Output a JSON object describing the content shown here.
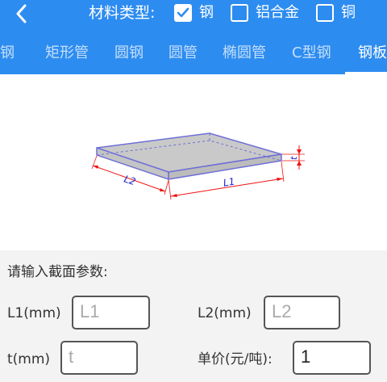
{
  "header": {
    "material_label": "材料类型:",
    "checkboxes": [
      {
        "label": "钢",
        "checked": true
      },
      {
        "label": "铝合金",
        "checked": false
      },
      {
        "label": "铜",
        "checked": false
      }
    ],
    "bg_color": "#2d8cf0"
  },
  "tabs": [
    {
      "label": "角钢",
      "active": false
    },
    {
      "label": "矩形管",
      "active": false
    },
    {
      "label": "圆钢",
      "active": false
    },
    {
      "label": "圆管",
      "active": false
    },
    {
      "label": "椭圆管",
      "active": false
    },
    {
      "label": "C型钢",
      "active": false
    },
    {
      "label": "钢板",
      "active": true
    }
  ],
  "diagram": {
    "dim_l2": "L2",
    "dim_l1": "L1",
    "dim_t": "t"
  },
  "form": {
    "title": "请输入截面参数:",
    "fields": [
      {
        "label": "L1(mm)",
        "placeholder": "L1",
        "value": ""
      },
      {
        "label": "L2(mm)",
        "placeholder": "L2",
        "value": ""
      },
      {
        "label": "t(mm)",
        "placeholder": "t",
        "value": ""
      },
      {
        "label": "单价(元/吨):",
        "placeholder": "",
        "value": "1"
      }
    ]
  }
}
